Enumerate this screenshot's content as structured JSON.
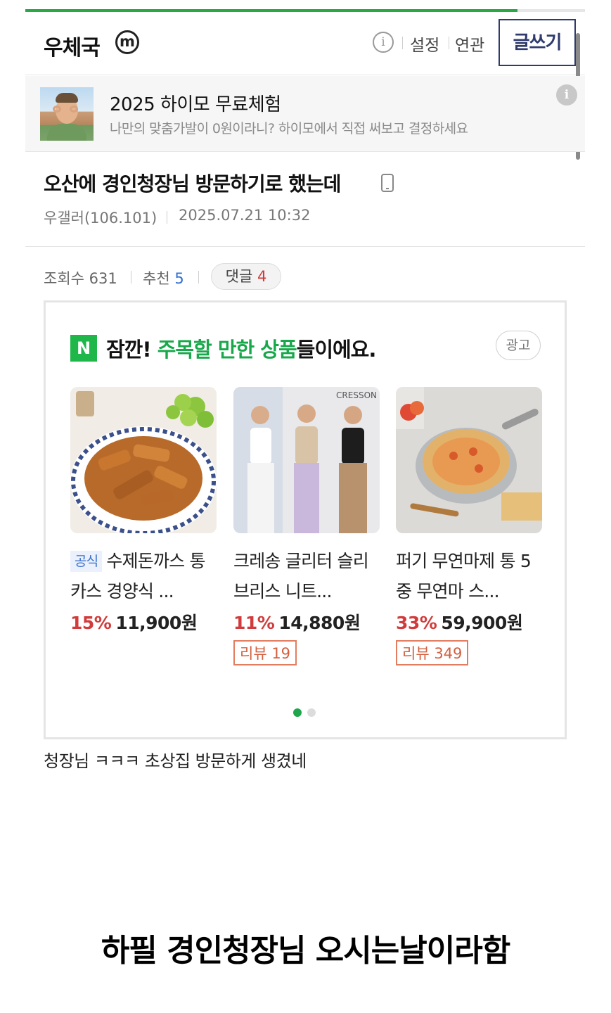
{
  "progress": {
    "fraction": 0.88,
    "color": "#2aa846"
  },
  "header": {
    "gallery_name": "우체국",
    "badge": "m",
    "info_icon": "i",
    "settings": "설정",
    "related": "연관",
    "write_button": "글쓰기"
  },
  "promo": {
    "title": "2025 하이모 무료체험",
    "subtitle": "나만의 맞춤가발이 0원이라니? 하이모에서 직접 써보고 결정하세요",
    "info_icon": "i"
  },
  "post": {
    "title": "오산에 경인청장님 방문하기로 했는데",
    "author": "우갤러(106.101)",
    "datetime": "2025.07.21 10:32",
    "views_label": "조회수 631",
    "recommend_label": "추천",
    "recommend_count": "5",
    "comment_label": "댓글",
    "comment_count": "4",
    "body": "청장님 ㅋㅋㅋ 초상집 방문하게 생겼네"
  },
  "ad": {
    "logo": "N",
    "title_prefix": "잠깐! ",
    "title_highlight": "주목할 만한 상품",
    "title_suffix": "들이에요.",
    "tag": "광고",
    "products": [
      {
        "official": "공식",
        "name": "수제돈까스 통카스 경양식 ...",
        "discount": "15%",
        "price": "11,900원",
        "review": ""
      },
      {
        "official": "",
        "name": "크레송 글리터 슬리브리스 니트...",
        "discount": "11%",
        "price": "14,880원",
        "review": "리뷰 19",
        "image_text": "CRESSON"
      },
      {
        "official": "",
        "name": "퍼기 무연마제 통 5중 무연마 스...",
        "discount": "33%",
        "price": "59,900원",
        "review": "리뷰 349"
      }
    ]
  },
  "caption": "하필 경인청장님 오시는날이라함"
}
